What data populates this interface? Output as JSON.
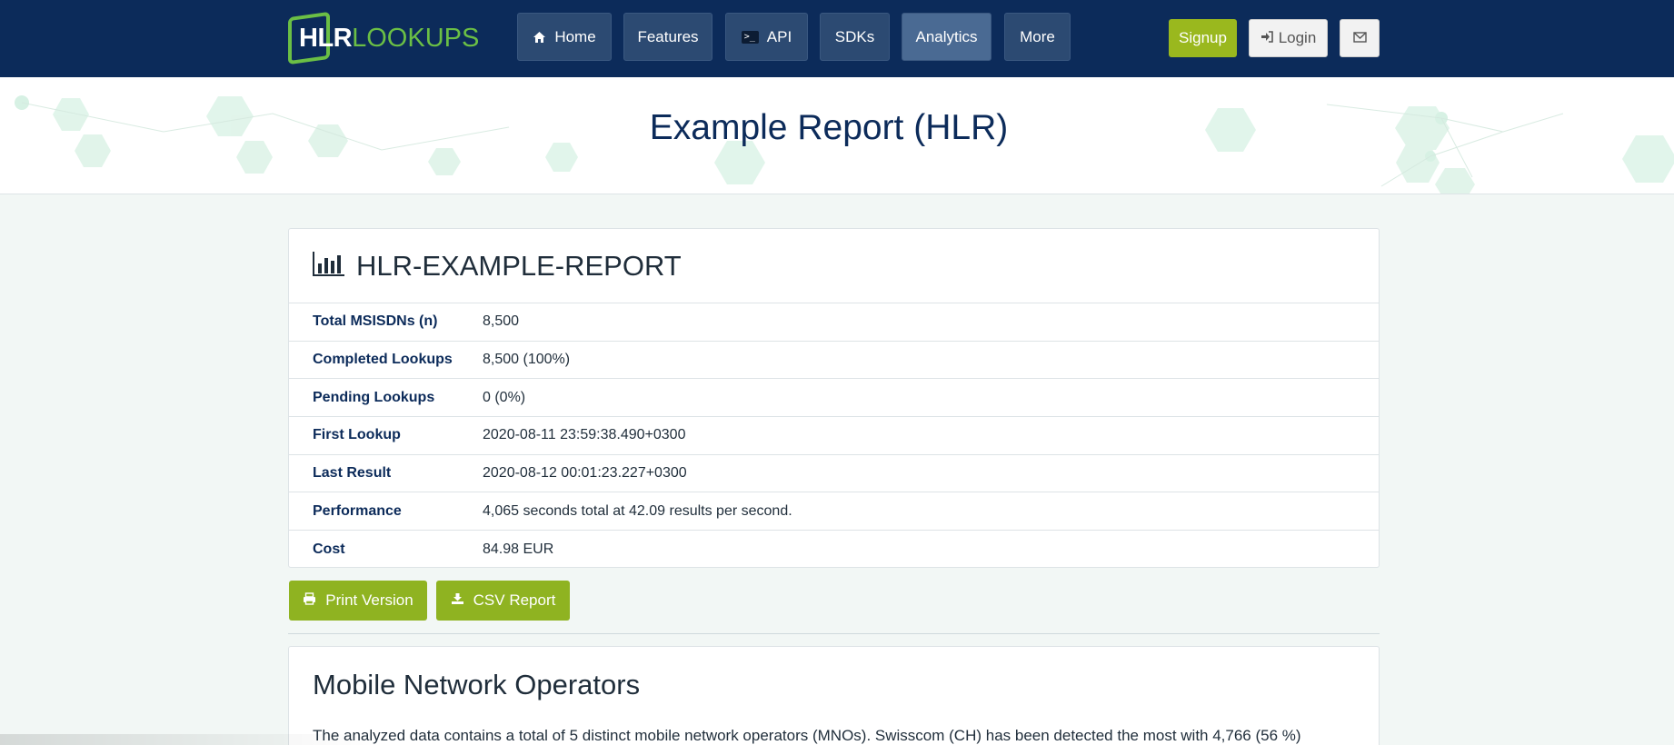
{
  "brand": {
    "hlr": "HLR",
    "lookups": "LOOKUPS",
    "accent": "#6bbf45",
    "navy": "#0c2b5a"
  },
  "nav": {
    "home": "Home",
    "features": "Features",
    "api": "API",
    "sdks": "SDKs",
    "analytics": "Analytics",
    "more": "More"
  },
  "auth": {
    "signup": "Signup",
    "login": "Login"
  },
  "hero": {
    "title": "Example Report (HLR)"
  },
  "report": {
    "title": "HLR-EXAMPLE-REPORT",
    "rows": [
      {
        "label": "Total MSISDNs (n)",
        "value": "8,500"
      },
      {
        "label": "Completed Lookups",
        "value": "8,500 (100%)"
      },
      {
        "label": "Pending Lookups",
        "value": "0 (0%)"
      },
      {
        "label": "First Lookup",
        "value": "2020-08-11 23:59:38.490+0300"
      },
      {
        "label": "Last Result",
        "value": "2020-08-12 00:01:23.227+0300"
      },
      {
        "label": "Performance",
        "value": "4,065 seconds total at 42.09 results per second."
      },
      {
        "label": "Cost",
        "value": "84.98 EUR"
      }
    ]
  },
  "actions": {
    "print": "Print Version",
    "csv": "CSV Report",
    "color": "#8fb321"
  },
  "mno": {
    "title": "Mobile Network Operators",
    "text": "The analyzed data contains a total of 5 distinct mobile network operators (MNOs). Swisscom (CH) has been detected the most with 4,766 (56 %)"
  },
  "icons": [
    "home-icon",
    "terminal-icon",
    "login-icon",
    "mail-icon",
    "bar-chart-icon",
    "print-icon",
    "download-icon"
  ]
}
